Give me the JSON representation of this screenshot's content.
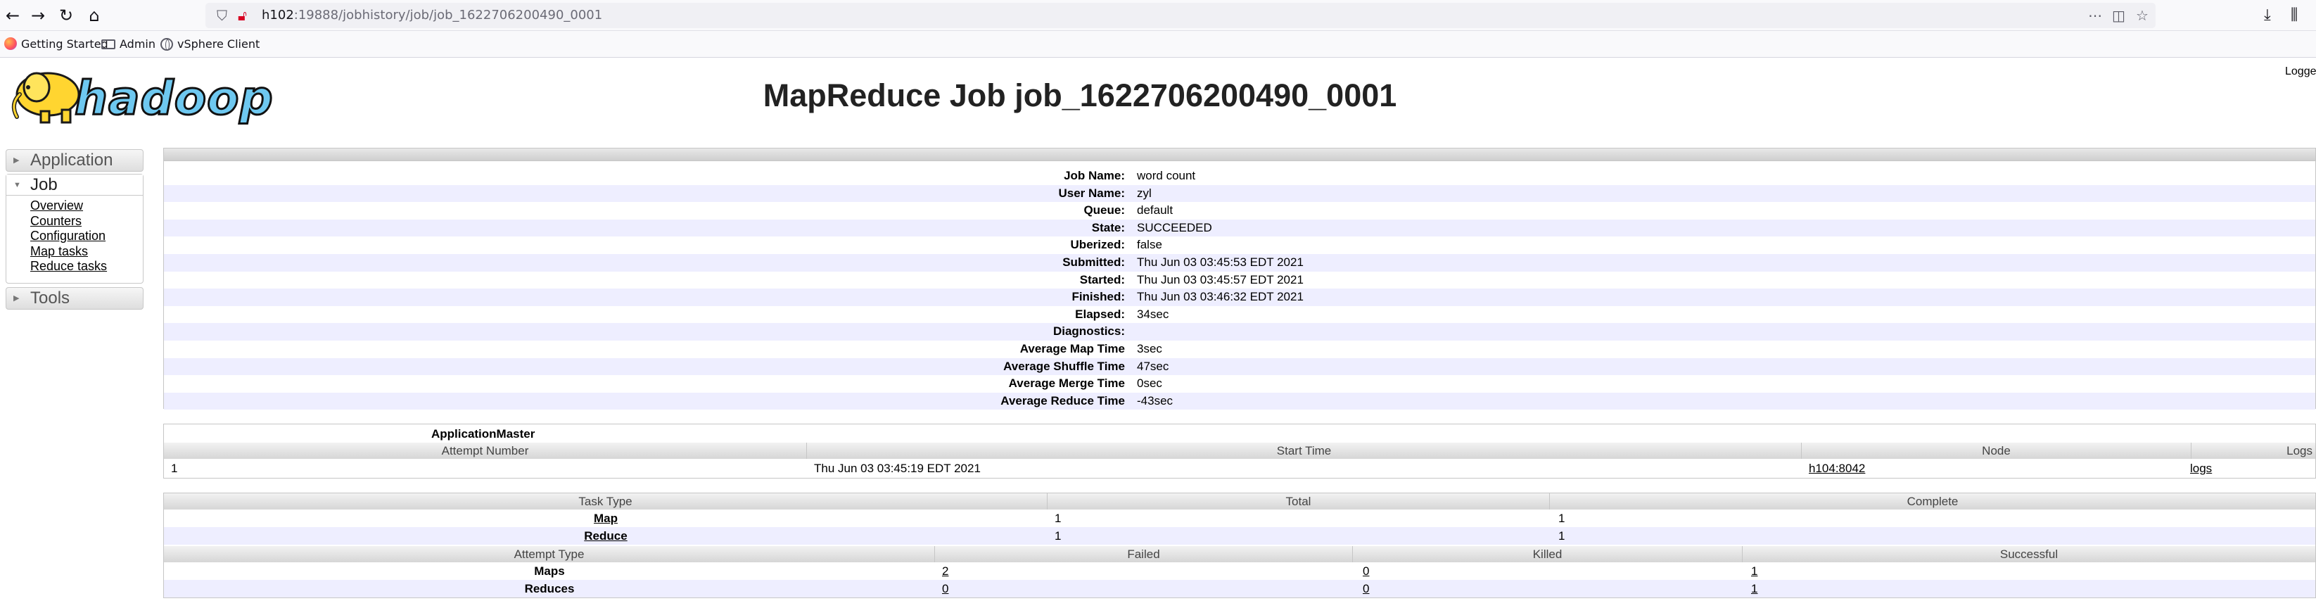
{
  "browser": {
    "url_host": "h102",
    "url_rest": ":19888/jobhistory/job/job_1622706200490_0001",
    "bookmarks": [
      "Getting Started",
      "Admin",
      "vSphere Client"
    ]
  },
  "header": {
    "logo_text": "hadoop",
    "title": "MapReduce Job job_1622706200490_0001",
    "logged_in": "Logge"
  },
  "nav": {
    "application": "Application",
    "job": "Job",
    "job_links": [
      "Overview",
      "Counters",
      "Configuration",
      "Map tasks",
      "Reduce tasks"
    ],
    "tools": "Tools"
  },
  "job_info": [
    {
      "key": "Job Name:",
      "value": "word count"
    },
    {
      "key": "User Name:",
      "value": "zyl"
    },
    {
      "key": "Queue:",
      "value": "default"
    },
    {
      "key": "State:",
      "value": "SUCCEEDED"
    },
    {
      "key": "Uberized:",
      "value": "false"
    },
    {
      "key": "Submitted:",
      "value": "Thu Jun 03 03:45:53 EDT 2021"
    },
    {
      "key": "Started:",
      "value": "Thu Jun 03 03:45:57 EDT 2021"
    },
    {
      "key": "Finished:",
      "value": "Thu Jun 03 03:46:32 EDT 2021"
    },
    {
      "key": "Elapsed:",
      "value": "34sec"
    },
    {
      "key": "Diagnostics:",
      "value": ""
    },
    {
      "key": "Average Map Time",
      "value": "3sec"
    },
    {
      "key": "Average Shuffle Time",
      "value": "47sec"
    },
    {
      "key": "Average Merge Time",
      "value": "0sec"
    },
    {
      "key": "Average Reduce Time",
      "value": "-43sec"
    }
  ],
  "app_master": {
    "title": "ApplicationMaster",
    "headers": [
      "Attempt Number",
      "Start Time",
      "Node",
      "Logs"
    ],
    "row": {
      "attempt": "1",
      "start_time": "Thu Jun 03 03:45:19 EDT 2021",
      "node": "h104:8042",
      "logs": "logs"
    }
  },
  "tasks": {
    "headers": [
      "Task Type",
      "Total",
      "Complete"
    ],
    "rows": [
      {
        "type": "Map",
        "total": "1",
        "complete": "1"
      },
      {
        "type": "Reduce",
        "total": "1",
        "complete": "1"
      }
    ]
  },
  "attempts": {
    "headers": [
      "Attempt Type",
      "Failed",
      "Killed",
      "Successful"
    ],
    "rows": [
      {
        "type": "Maps",
        "failed": "2",
        "killed": "0",
        "successful": "1"
      },
      {
        "type": "Reduces",
        "failed": "0",
        "killed": "0",
        "successful": "1"
      }
    ]
  }
}
